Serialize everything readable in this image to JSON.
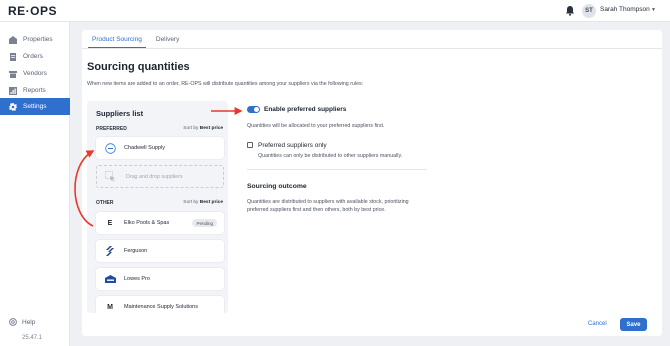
{
  "app": {
    "logo": "RE·OPS"
  },
  "topbar": {
    "avatar_initials": "ST",
    "user_name": "Sarah Thompson",
    "notification_icon": "bell-icon"
  },
  "sidebar": {
    "items": [
      {
        "label": "Properties",
        "icon": "building-icon"
      },
      {
        "label": "Orders",
        "icon": "document-icon"
      },
      {
        "label": "Vendors",
        "icon": "store-icon"
      },
      {
        "label": "Reports",
        "icon": "chart-icon"
      },
      {
        "label": "Settings",
        "icon": "gear-icon",
        "active": true
      }
    ],
    "help_label": "Help",
    "version": "25.47.1"
  },
  "tabs": [
    {
      "label": "Product Sourcing",
      "active": true
    },
    {
      "label": "Delivery",
      "active": false
    }
  ],
  "page": {
    "title": "Sourcing quantities",
    "description": "When new items are added to an order, RE-OPS will distribute quantities among your suppliers via the following rules:"
  },
  "suppliers": {
    "title": "Suppliers list",
    "preferred_label": "PREFERRED",
    "other_label": "OTHER",
    "sort_prefix": "Sort by",
    "sort_value": "Best price",
    "preferred": [
      {
        "name": "Chadwell Supply"
      }
    ],
    "dropzone_label": "Drag and drop suppliers",
    "other": [
      {
        "name": "Elko Pools & Spas",
        "badge": "Pending",
        "logo": "E"
      },
      {
        "name": "Ferguson",
        "logo": "ferguson"
      },
      {
        "name": "Lowes Pro",
        "logo": "lowes"
      },
      {
        "name": "Maintenance Supply Solutions",
        "logo": "M"
      }
    ]
  },
  "options": {
    "enable_preferred": {
      "label": "Enable preferred suppliers",
      "enabled": true,
      "description": "Quantities will be allocated to your preferred suppliers first."
    },
    "preferred_only": {
      "label": "Preferred suppliers only",
      "checked": false,
      "description": "Quantities can only be distributed to other suppliers manually."
    }
  },
  "outcome": {
    "title": "Sourcing outcome",
    "description": "Quantities are distributed to suppliers with available stock, prioritizing preferred suppliers first and then others, both by best price."
  },
  "footer": {
    "cancel_label": "Cancel",
    "save_label": "Save"
  },
  "colors": {
    "accent": "#2f6fce",
    "annotation": "#e8382b"
  }
}
